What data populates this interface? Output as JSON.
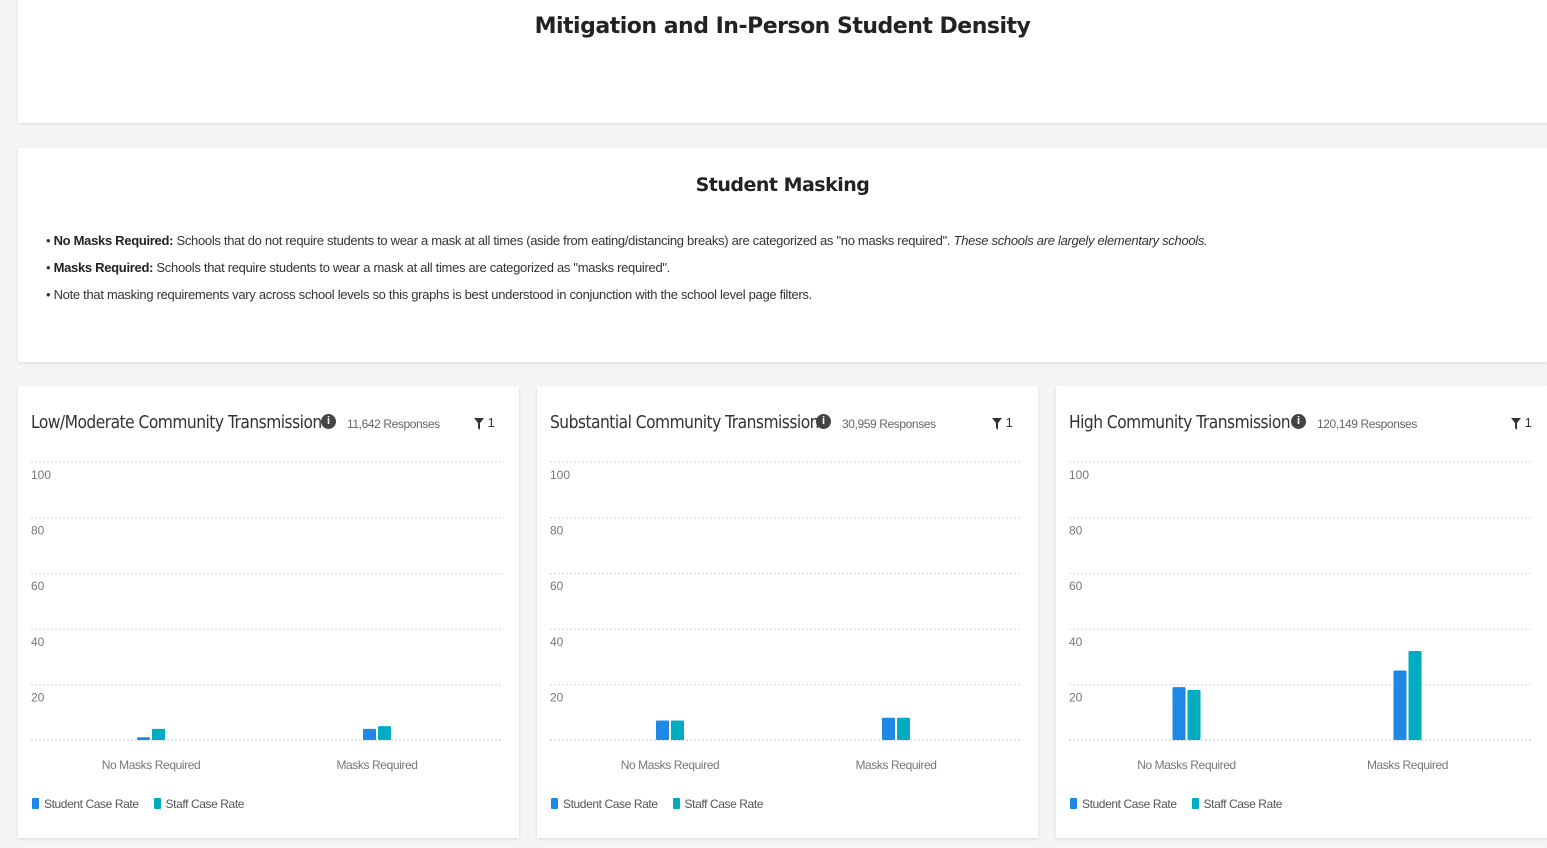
{
  "header": {
    "title": "Mitigation and In-Person Student Density"
  },
  "info": {
    "title": "Student Masking",
    "bullets": [
      {
        "bold": "No Masks Required:",
        "text": " Schools that do not require students to wear a mask at all times (aside from eating/distancing breaks) are categorized as \"no masks required\". ",
        "italic": "These schools are largely elementary schools."
      },
      {
        "bold": "Masks Required:",
        "text": " Schools that require students to wear a mask at all times are categorized as \"masks required\".",
        "italic": ""
      },
      {
        "bold": "",
        "text": "Note that masking requirements vary across school levels so this graphs is best understood in conjunction with the school level page filters.",
        "italic": ""
      }
    ]
  },
  "colors": {
    "student": "#1e88e5",
    "staff": "#00acc1",
    "grid": "#cfd3d8"
  },
  "info_icon": "info-circle-icon",
  "filter_icon": "filter-icon",
  "chart_data": [
    {
      "type": "bar",
      "title": "Low/Moderate Community Transmission",
      "responses": "11,642 Responses",
      "filter_count": "1",
      "categories": [
        "No Masks Required",
        "Masks Required"
      ],
      "series": [
        {
          "name": "Student Case Rate",
          "values": [
            1,
            4
          ]
        },
        {
          "name": "Staff Case Rate",
          "values": [
            4,
            5
          ]
        }
      ],
      "ylim": [
        0,
        100
      ],
      "yticks": [
        "100",
        "80",
        "60",
        "40",
        "20"
      ],
      "grid": true,
      "legend": "bottom-left"
    },
    {
      "type": "bar",
      "title": "Substantial Community Transmission",
      "responses": "30,959 Responses",
      "filter_count": "1",
      "categories": [
        "No Masks Required",
        "Masks Required"
      ],
      "series": [
        {
          "name": "Student Case Rate",
          "values": [
            7,
            8
          ]
        },
        {
          "name": "Staff Case Rate",
          "values": [
            7,
            8
          ]
        }
      ],
      "ylim": [
        0,
        100
      ],
      "yticks": [
        "100",
        "80",
        "60",
        "40",
        "20"
      ],
      "grid": true,
      "legend": "bottom-left"
    },
    {
      "type": "bar",
      "title": "High Community Transmission",
      "responses": "120,149 Responses",
      "filter_count": "1",
      "categories": [
        "No Masks Required",
        "Masks Required"
      ],
      "series": [
        {
          "name": "Student Case Rate",
          "values": [
            19,
            25
          ]
        },
        {
          "name": "Staff Case Rate",
          "values": [
            18,
            32
          ]
        }
      ],
      "ylim": [
        0,
        100
      ],
      "yticks": [
        "100",
        "80",
        "60",
        "40",
        "20"
      ],
      "grid": true,
      "legend": "bottom-left"
    }
  ]
}
